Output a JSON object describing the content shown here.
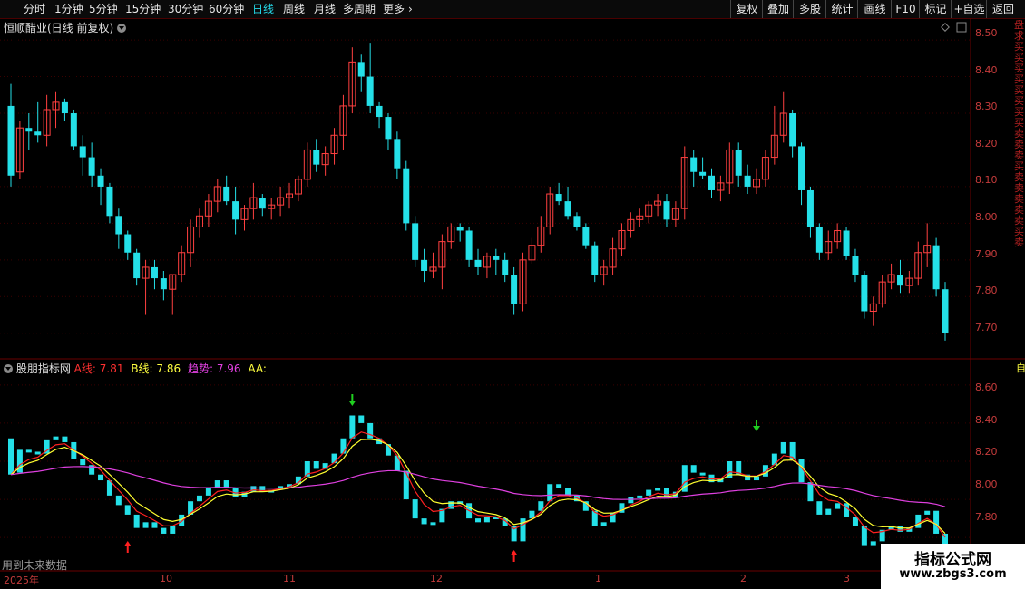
{
  "toolbar": {
    "periods": [
      "分时",
      "1分钟",
      "5分钟",
      "15分钟",
      "30分钟",
      "60分钟",
      "日线",
      "周线",
      "月线",
      "多周期",
      "更多"
    ],
    "active_period": "日线",
    "right_buttons": [
      "复权",
      "叠加",
      "多股",
      "统计",
      "画线",
      "F10",
      "标记",
      "+自选",
      "返回"
    ]
  },
  "main_title": "恒顺醋业(日线 前复权)",
  "price_axis": [
    "8.50",
    "8.40",
    "8.30",
    "8.20",
    "8.10",
    "8.00",
    "7.90",
    "7.80",
    "7.70"
  ],
  "indicator": {
    "name": "股朋指标网",
    "a_label": "A线:",
    "a_value": "7.81",
    "b_label": "B线:",
    "b_value": "7.86",
    "trend_label": "趋势:",
    "trend_value": "7.96",
    "aa_label": "AA:",
    "axis": [
      "8.60",
      "8.40",
      "8.20",
      "8.00",
      "7.80"
    ]
  },
  "date_axis": [
    "2025年",
    "10",
    "11",
    "12",
    "1",
    "2",
    "3"
  ],
  "future_note": "用到未来数据",
  "sidebar_chars": "盘求买买买买买买买买卖卖卖买卖卖卖卖卖买卖",
  "indicator_side": "自",
  "watermark": {
    "title": "指标公式网",
    "url": "www.zbgs3.com"
  },
  "colors": {
    "up": "#ff4040",
    "down": "#24e0e8",
    "a_line": "#ff2020",
    "b_line": "#ffff30",
    "trend": "#e040e0",
    "active": "#24d6e6"
  },
  "chart_data": {
    "type": "candlestick",
    "title": "恒顺醋业(日线 前复权)",
    "ylim": [
      7.65,
      8.52
    ],
    "ohlc": [
      [
        8.32,
        8.38,
        8.1,
        8.13
      ],
      [
        8.14,
        8.28,
        8.12,
        8.26
      ],
      [
        8.26,
        8.3,
        8.2,
        8.25
      ],
      [
        8.25,
        8.33,
        8.22,
        8.24
      ],
      [
        8.24,
        8.35,
        8.21,
        8.31
      ],
      [
        8.31,
        8.36,
        8.26,
        8.33
      ],
      [
        8.33,
        8.34,
        8.28,
        8.3
      ],
      [
        8.3,
        8.31,
        8.2,
        8.21
      ],
      [
        8.21,
        8.24,
        8.13,
        8.18
      ],
      [
        8.18,
        8.22,
        8.1,
        8.13
      ],
      [
        8.13,
        8.15,
        8.05,
        8.1
      ],
      [
        8.1,
        8.11,
        8.0,
        8.02
      ],
      [
        8.02,
        8.04,
        7.93,
        7.97
      ],
      [
        7.97,
        7.98,
        7.9,
        7.92
      ],
      [
        7.92,
        7.93,
        7.83,
        7.85
      ],
      [
        7.85,
        7.9,
        7.75,
        7.88
      ],
      [
        7.88,
        7.9,
        7.82,
        7.85
      ],
      [
        7.85,
        7.87,
        7.79,
        7.82
      ],
      [
        7.82,
        7.86,
        7.75,
        7.86
      ],
      [
        7.86,
        7.94,
        7.84,
        7.92
      ],
      [
        7.92,
        8.01,
        7.88,
        7.99
      ],
      [
        7.99,
        8.04,
        7.96,
        8.02
      ],
      [
        8.02,
        8.08,
        7.99,
        8.06
      ],
      [
        8.06,
        8.12,
        8.03,
        8.1
      ],
      [
        8.1,
        8.13,
        8.05,
        8.06
      ],
      [
        8.06,
        8.1,
        7.97,
        8.01
      ],
      [
        8.01,
        8.05,
        7.98,
        8.04
      ],
      [
        8.04,
        8.11,
        8.01,
        8.07
      ],
      [
        8.07,
        8.08,
        8.02,
        8.04
      ],
      [
        8.04,
        8.07,
        8.01,
        8.05
      ],
      [
        8.05,
        8.1,
        8.02,
        8.07
      ],
      [
        8.07,
        8.11,
        8.04,
        8.08
      ],
      [
        8.08,
        8.13,
        8.06,
        8.12
      ],
      [
        8.12,
        8.22,
        8.1,
        8.2
      ],
      [
        8.2,
        8.23,
        8.14,
        8.16
      ],
      [
        8.16,
        8.21,
        8.13,
        8.19
      ],
      [
        8.19,
        8.26,
        8.16,
        8.24
      ],
      [
        8.24,
        8.35,
        8.2,
        8.32
      ],
      [
        8.32,
        8.48,
        8.3,
        8.44
      ],
      [
        8.44,
        8.46,
        8.36,
        8.4
      ],
      [
        8.4,
        8.49,
        8.3,
        8.32
      ],
      [
        8.32,
        8.33,
        8.26,
        8.29
      ],
      [
        8.29,
        8.3,
        8.2,
        8.23
      ],
      [
        8.23,
        8.25,
        8.12,
        8.15
      ],
      [
        8.15,
        8.17,
        7.98,
        8.0
      ],
      [
        8.0,
        8.02,
        7.88,
        7.9
      ],
      [
        7.9,
        7.93,
        7.84,
        7.87
      ],
      [
        7.87,
        7.92,
        7.85,
        7.88
      ],
      [
        7.88,
        7.97,
        7.82,
        7.95
      ],
      [
        7.95,
        8.0,
        7.93,
        7.99
      ],
      [
        7.99,
        8.0,
        7.95,
        7.98
      ],
      [
        7.98,
        7.99,
        7.88,
        7.9
      ],
      [
        7.9,
        7.93,
        7.86,
        7.88
      ],
      [
        7.88,
        7.92,
        7.85,
        7.91
      ],
      [
        7.91,
        7.93,
        7.86,
        7.9
      ],
      [
        7.9,
        7.92,
        7.84,
        7.86
      ],
      [
        7.86,
        7.88,
        7.75,
        7.78
      ],
      [
        7.78,
        7.92,
        7.76,
        7.9
      ],
      [
        7.9,
        7.96,
        7.89,
        7.94
      ],
      [
        7.94,
        8.02,
        7.92,
        7.99
      ],
      [
        7.99,
        8.1,
        7.97,
        8.08
      ],
      [
        8.08,
        8.11,
        8.05,
        8.06
      ],
      [
        8.06,
        8.1,
        8.01,
        8.02
      ],
      [
        8.02,
        8.03,
        7.98,
        7.99
      ],
      [
        7.99,
        8.0,
        7.93,
        7.94
      ],
      [
        7.94,
        7.95,
        7.84,
        7.86
      ],
      [
        7.86,
        7.9,
        7.83,
        7.88
      ],
      [
        7.88,
        7.96,
        7.86,
        7.93
      ],
      [
        7.93,
        8.0,
        7.91,
        7.98
      ],
      [
        7.98,
        8.03,
        7.96,
        8.01
      ],
      [
        8.01,
        8.04,
        7.99,
        8.02
      ],
      [
        8.02,
        8.06,
        8.0,
        8.05
      ],
      [
        8.05,
        8.08,
        8.02,
        8.06
      ],
      [
        8.06,
        8.08,
        7.99,
        8.01
      ],
      [
        8.01,
        8.06,
        7.99,
        8.04
      ],
      [
        8.04,
        8.21,
        8.01,
        8.18
      ],
      [
        8.18,
        8.2,
        8.1,
        8.14
      ],
      [
        8.14,
        8.18,
        8.12,
        8.13
      ],
      [
        8.13,
        8.15,
        8.07,
        8.09
      ],
      [
        8.09,
        8.13,
        8.06,
        8.11
      ],
      [
        8.11,
        8.22,
        8.08,
        8.2
      ],
      [
        8.2,
        8.22,
        8.1,
        8.13
      ],
      [
        8.13,
        8.16,
        8.08,
        8.1
      ],
      [
        8.1,
        8.15,
        8.08,
        8.12
      ],
      [
        8.12,
        8.2,
        8.1,
        8.18
      ],
      [
        8.18,
        8.32,
        8.16,
        8.24
      ],
      [
        8.24,
        8.36,
        8.22,
        8.3
      ],
      [
        8.3,
        8.31,
        8.18,
        8.21
      ],
      [
        8.21,
        8.22,
        8.05,
        8.09
      ],
      [
        8.09,
        8.1,
        7.96,
        7.99
      ],
      [
        7.99,
        8.0,
        7.9,
        7.92
      ],
      [
        7.92,
        7.98,
        7.9,
        7.95
      ],
      [
        7.95,
        8.0,
        7.93,
        7.98
      ],
      [
        7.98,
        7.99,
        7.9,
        7.91
      ],
      [
        7.91,
        7.93,
        7.84,
        7.86
      ],
      [
        7.86,
        7.87,
        7.74,
        7.76
      ],
      [
        7.76,
        7.8,
        7.72,
        7.78
      ],
      [
        7.78,
        7.86,
        7.77,
        7.84
      ],
      [
        7.84,
        7.89,
        7.82,
        7.86
      ],
      [
        7.86,
        7.9,
        7.81,
        7.83
      ],
      [
        7.83,
        7.87,
        7.81,
        7.85
      ],
      [
        7.85,
        7.95,
        7.83,
        7.92
      ],
      [
        7.92,
        8.0,
        7.88,
        7.94
      ],
      [
        7.94,
        7.96,
        7.8,
        7.82
      ],
      [
        7.82,
        7.84,
        7.68,
        7.7
      ]
    ]
  }
}
